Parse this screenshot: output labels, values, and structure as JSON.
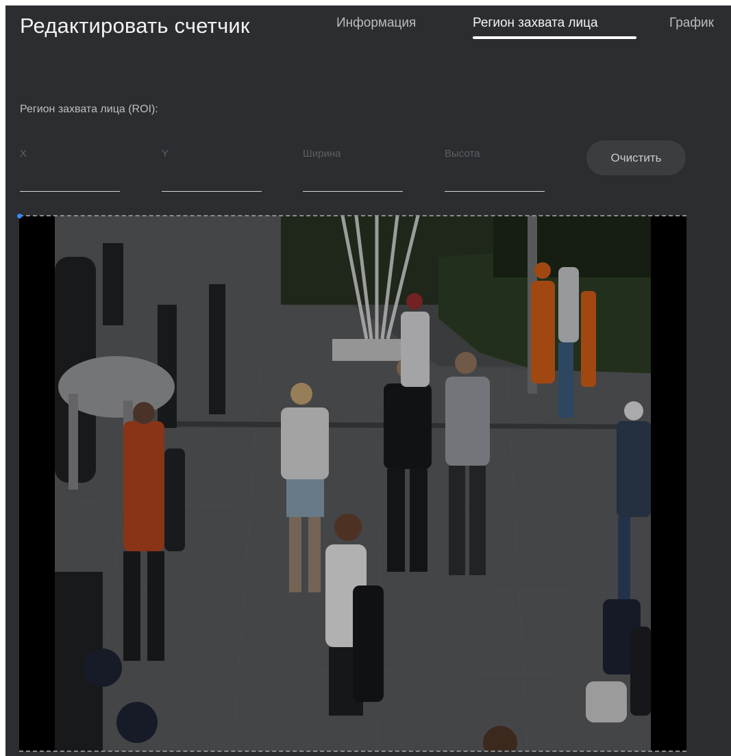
{
  "header": {
    "title": "Редактировать счетчик",
    "tabs": [
      {
        "label": "Информация",
        "active": false
      },
      {
        "label": "Регион захвата лица",
        "active": true
      },
      {
        "label": "График",
        "active": false
      }
    ]
  },
  "roi": {
    "section_label": "Регион захвата лица (ROI):",
    "fields": {
      "x": {
        "label": "X",
        "value": ""
      },
      "y": {
        "label": "Y",
        "value": ""
      },
      "width": {
        "label": "Ширина",
        "value": ""
      },
      "height": {
        "label": "Высота",
        "value": ""
      }
    },
    "clear_label": "Очистить"
  },
  "preview": {
    "description": "camera-snapshot",
    "colors": {
      "panel_bg": "#2b2d30",
      "active_tab_underline": "#ffffff",
      "roi_handle": "#2f8cff"
    }
  }
}
